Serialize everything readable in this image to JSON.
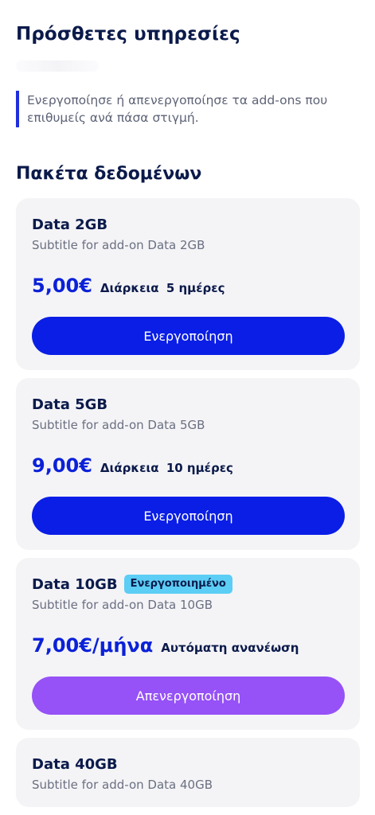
{
  "header": {
    "title": "Πρόσθετες υπηρεσίες"
  },
  "info_note": "Ενεργοποίησε ή απενεργοποίησε τα add-ons που επιθυμείς ανά πάσα στιγμή.",
  "section": {
    "title": "Πακέτα δεδομένων"
  },
  "colors": {
    "activate_button": "#0a1ee6",
    "deactivate_button": "#9651f7",
    "price": "#0b21d8",
    "badge": "#5ccdf5"
  },
  "cards": [
    {
      "title": "Data 2GB",
      "subtitle": "Subtitle for add-on Data 2GB",
      "price": "5,00€",
      "duration_label": "Διάρκεια",
      "duration_value": "5 ημέρες",
      "button_label": "Ενεργοποίηση"
    },
    {
      "title": "Data 5GB",
      "subtitle": "Subtitle for add-on Data 5GB",
      "price": "9,00€",
      "duration_label": "Διάρκεια",
      "duration_value": "10 ημέρες",
      "button_label": "Ενεργοποίηση"
    },
    {
      "title": "Data 10GB",
      "badge": "Ενεργοποιημένο",
      "subtitle": "Subtitle for add-on Data 10GB",
      "price": "7,00€/μήνα",
      "renewal": "Αυτόματη ανανέωση",
      "button_label": "Απενεργοποίηση"
    },
    {
      "title": "Data 40GB",
      "subtitle": "Subtitle for add-on Data 40GB"
    }
  ]
}
